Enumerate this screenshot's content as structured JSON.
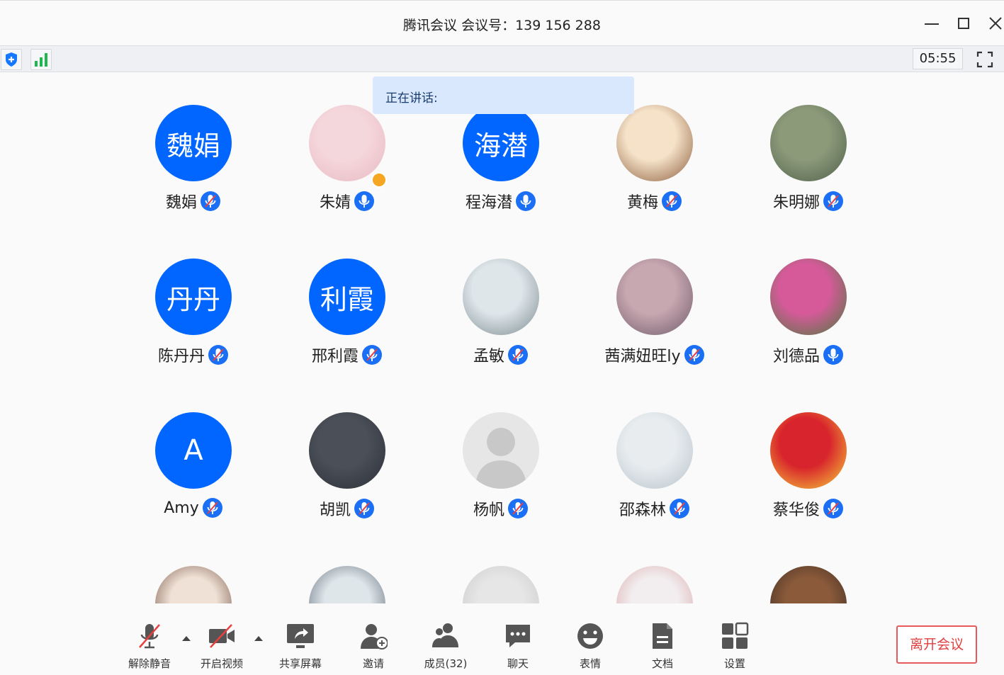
{
  "window": {
    "title": "腾讯会议 会议号：139 156 288"
  },
  "toolbar": {
    "timer": "05:55"
  },
  "speaking": {
    "label": "正在讲话:"
  },
  "participants": [
    {
      "name": "魏娟",
      "avatar": "initials",
      "initials": "魏娟",
      "mic": "muted"
    },
    {
      "name": "朱婧",
      "avatar": "photo",
      "mic": "on",
      "host": true
    },
    {
      "name": "程海潜",
      "avatar": "initials",
      "initials": "海潜",
      "mic": "on"
    },
    {
      "name": "黄梅",
      "avatar": "photo",
      "mic": "muted"
    },
    {
      "name": "朱明娜",
      "avatar": "photo",
      "mic": "muted"
    },
    {
      "name": "陈丹丹",
      "avatar": "initials",
      "initials": "丹丹",
      "mic": "muted"
    },
    {
      "name": "邢利霞",
      "avatar": "initials",
      "initials": "利霞",
      "mic": "muted"
    },
    {
      "name": "孟敏",
      "avatar": "photo",
      "mic": "muted"
    },
    {
      "name": "茜满妞旺ly",
      "avatar": "photo",
      "mic": "muted"
    },
    {
      "name": "刘德品",
      "avatar": "photo",
      "mic": "on"
    },
    {
      "name": "Amy",
      "avatar": "initials",
      "initials": "A",
      "mic": "muted"
    },
    {
      "name": "胡凯",
      "avatar": "photo",
      "mic": "muted"
    },
    {
      "name": "杨帆",
      "avatar": "default",
      "mic": "muted"
    },
    {
      "name": "邵森林",
      "avatar": "photo",
      "mic": "muted"
    },
    {
      "name": "蔡华俊",
      "avatar": "photo",
      "mic": "muted"
    }
  ],
  "bottombar": {
    "unmute": "解除静音",
    "start_video": "开启视频",
    "share_screen": "共享屏幕",
    "invite": "邀请",
    "members": "成员(32)",
    "chat": "聊天",
    "reactions": "表情",
    "docs": "文档",
    "settings": "设置",
    "leave": "离开会议"
  },
  "colors": {
    "accent": "#0066ff",
    "speaking_bg": "#d9e8fc",
    "leave": "#e0403f"
  }
}
